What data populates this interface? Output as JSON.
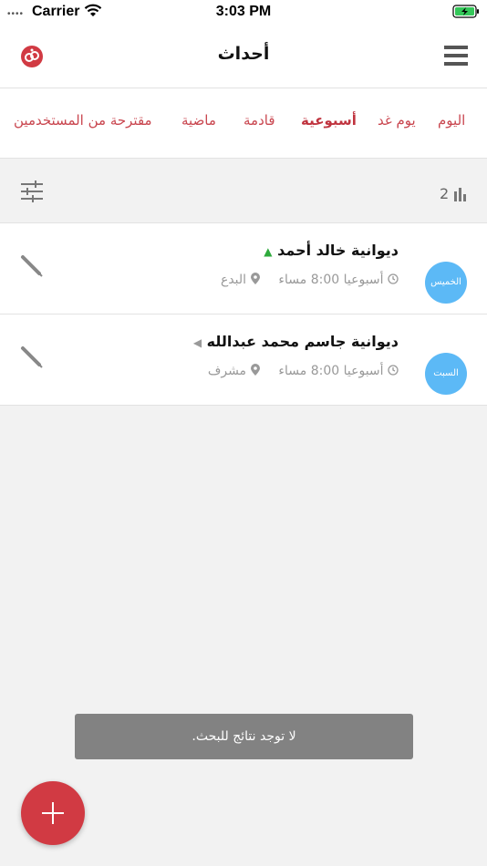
{
  "status_bar": {
    "signal": "••••",
    "carrier": "Carrier",
    "time": "3:03 PM",
    "wifi_icon": "wifi-icon",
    "battery_icon": "battery-charging-icon"
  },
  "header": {
    "title": "أحداث",
    "logo_icon": "app-logo-icon",
    "menu_icon": "hamburger-menu-icon"
  },
  "tabs": [
    {
      "label": "اليوم",
      "active": false
    },
    {
      "label": "يوم غد",
      "active": false
    },
    {
      "label": "أسبوعية",
      "active": true
    },
    {
      "label": "قادمة",
      "active": false
    },
    {
      "label": "ماضية",
      "active": false
    },
    {
      "label": "مقترحة من المستخدمين",
      "active": false
    }
  ],
  "toolbar": {
    "count": "2",
    "filter_icon": "sliders-filter-icon",
    "stats_icon": "bar-chart-icon"
  },
  "events": [
    {
      "name": "ديوانية خالد أحمد",
      "indicator": "▲",
      "indicator_color": "#2eaa3c",
      "schedule": "أسبوعيا 8:00 مساء",
      "location": "البدع",
      "day": "الخميس"
    },
    {
      "name": "ديوانية جاسم محمد عبدالله",
      "indicator": "◀",
      "indicator_color": "#9a9a9a",
      "schedule": "أسبوعيا 8:00 مساء",
      "location": "مشرف",
      "day": "السبت"
    }
  ],
  "toast": {
    "message": "لا توجد نتائج للبحث."
  },
  "colors": {
    "accent": "#c9464f",
    "fab": "#d13a43",
    "day_badge": "#5cb9f6"
  }
}
